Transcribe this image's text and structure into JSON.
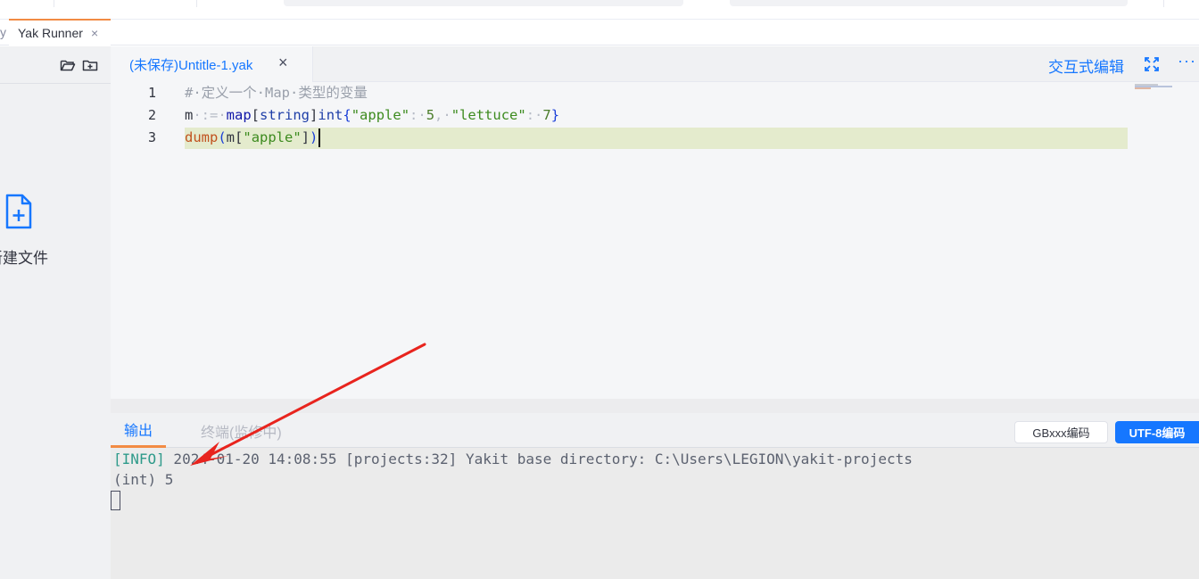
{
  "window": {
    "page_tab_cut": "y",
    "active_page_tab": "Yak Runner",
    "page_tab_close": "×"
  },
  "sidebar": {
    "new_file_label": "新建文件",
    "open_folder_icon": "folder-open-icon",
    "add_folder_icon": "folder-add-icon",
    "new_file_icon": "file-add-icon"
  },
  "editor": {
    "file_tab": "(未保存)Untitle-1.yak",
    "file_tab_close": "×",
    "interactive_edit": "交互式编辑",
    "more": "···",
    "line_numbers": [
      "1",
      "2",
      "3"
    ],
    "code": {
      "line1": "#·定义一个·Map·类型的变量",
      "line2": {
        "var": "m",
        "op": "·:=·",
        "kw": "map",
        "bracket_open": "[",
        "type1": "string",
        "bracket_close": "]",
        "type2": "int",
        "brace_open": "{",
        "key1": "\"apple\"",
        "colon1": ":·",
        "val1": "5",
        "comma": ",·",
        "key2": "\"lettuce\"",
        "colon2": ":·",
        "val2": "7",
        "brace_close": "}"
      },
      "line3": {
        "fn": "dump",
        "paren_open": "(",
        "var": "m",
        "bracket_open": "[",
        "key": "\"apple\"",
        "bracket_close": "]",
        "paren_close": ")"
      }
    }
  },
  "output": {
    "tab_output": "输出",
    "tab_terminal": "终端(监修中)",
    "encoding_gb": "GBxxx编码",
    "encoding_utf8": "UTF-8编码",
    "lines": {
      "info_tag": "[INFO]",
      "info_text": " 2024-01-20 14:08:55 [projects:32] Yakit base directory: C:\\Users\\LEGION\\yakit-projects",
      "result": "(int) 5"
    }
  },
  "colors": {
    "accent": "#1677ff",
    "tab_underline": "#f28b44",
    "annotation_arrow": "#e8241e",
    "current_line": "#e4ebcd"
  }
}
